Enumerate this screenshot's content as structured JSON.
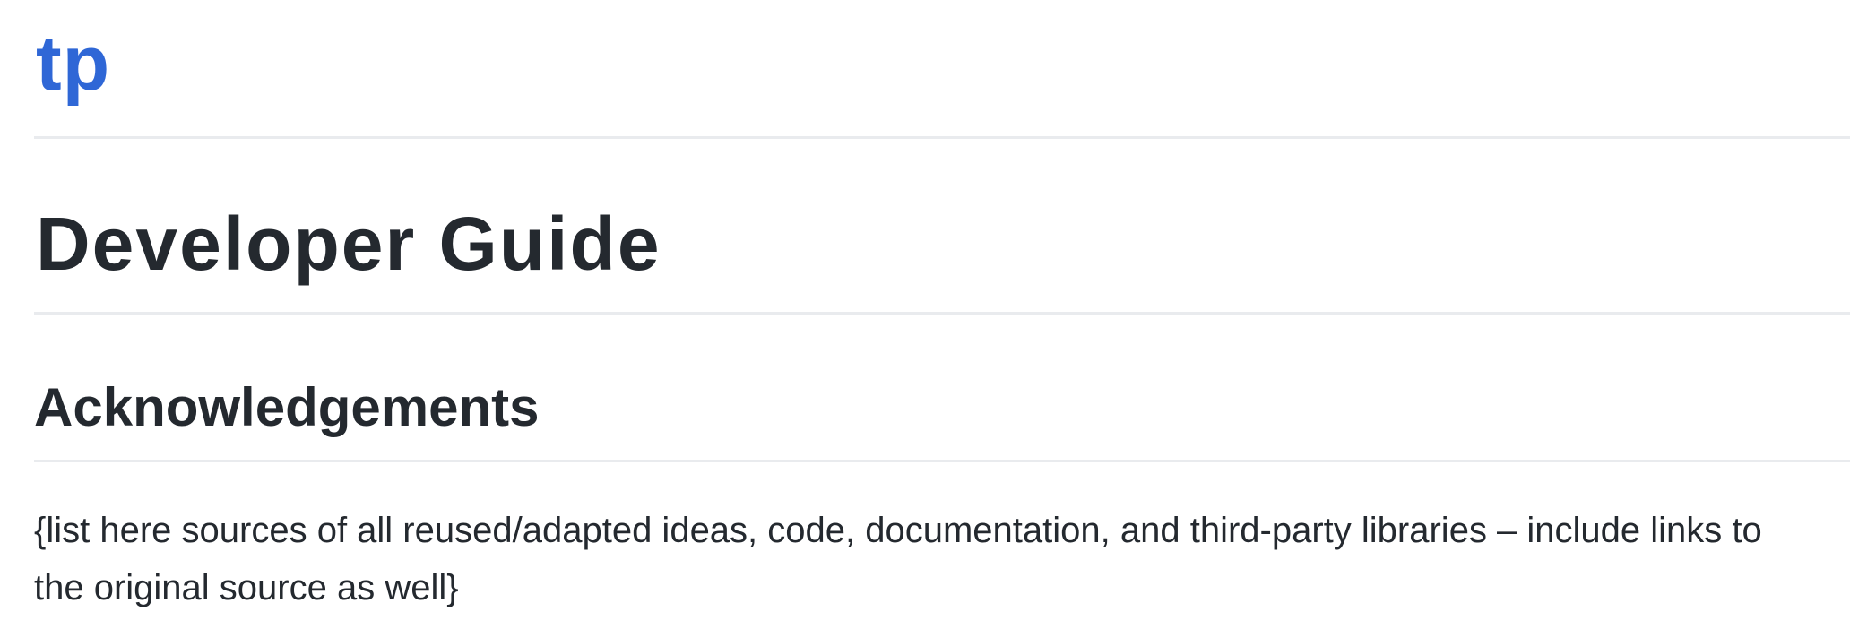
{
  "site": {
    "title": "tp",
    "brand_color": "#2f67d6"
  },
  "page": {
    "title": "Developer Guide"
  },
  "sections": [
    {
      "heading": "Acknowledgements",
      "body": "{list here sources of all reused/adapted ideas, code, documentation, and third-party libraries – include links to the original source as well}"
    }
  ],
  "colors": {
    "text": "#24292f",
    "divider": "#e9ebee",
    "background": "#ffffff"
  }
}
